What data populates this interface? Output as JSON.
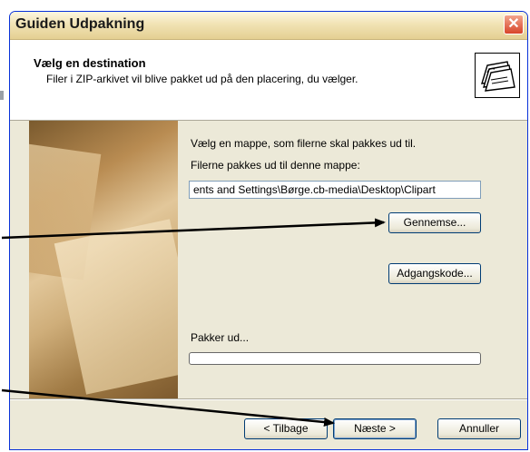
{
  "window": {
    "title": "Guiden Udpakning",
    "close_symbol": "✕"
  },
  "header": {
    "title": "Vælg en destination",
    "subtitle": "Filer i ZIP-arkivet vil blive pakket ud på den placering, du vælger."
  },
  "content": {
    "instruction": "Vælg en mappe, som filerne skal pakkes ud til.",
    "folder_label": "Filerne pakkes ud til denne mappe:",
    "folder_path": "ents and Settings\\Børge.cb-media\\Desktop\\Clipart",
    "browse_button": "Gennemse...",
    "password_button": "Adgangskode...",
    "progress_label": "Pakker ud...",
    "progress_value": 0
  },
  "footer": {
    "back_button": "< Tilbage",
    "next_button": "Næste >",
    "cancel_button": "Annuller"
  },
  "colors": {
    "title_bar": "#f1e3b4",
    "close_button": "#d8452a",
    "dialog_bg": "#ece9d8",
    "arrow": "#000000"
  },
  "icons": {
    "header_icon": "folder-zip-icon",
    "close": "close-icon"
  }
}
